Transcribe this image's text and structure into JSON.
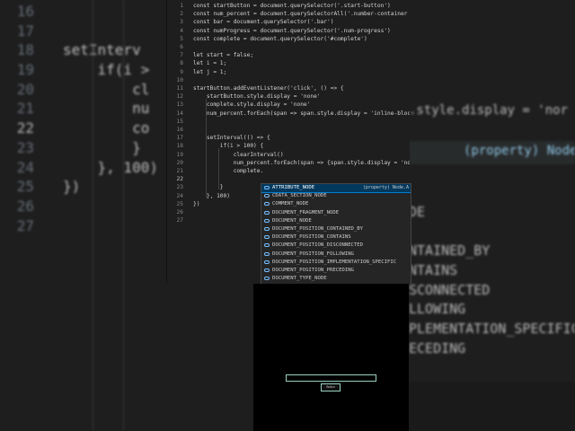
{
  "background": {
    "line_numbers": [
      "16",
      "17",
      "18",
      "19",
      "20",
      "21",
      "22",
      "23",
      "24",
      "25",
      "26",
      "27"
    ],
    "lines": [
      "",
      "",
      "setInterv",
      "    if(i >",
      "        cl",
      "        nu",
      "        co",
      "        }",
      "    }, 100)",
      "})",
      "",
      ""
    ],
    "right_top": ".style.display = 'nor",
    "hover_text": "(property) Node.A",
    "right_fragments": [
      "DE",
      "NTAINED_BY",
      "NTAINS",
      "SCONNECTED",
      "LLOWING",
      "PLEMENTATION_SPECIFIC",
      "ECEDING"
    ]
  },
  "editor": {
    "active_line": "22",
    "lines": [
      {
        "num": "1",
        "text": "const startButton = document.querySelector('.start-button')"
      },
      {
        "num": "2",
        "text": "const num_percent = document.querySelectorAll('.number-container span')"
      },
      {
        "num": "3",
        "text": "const bar = document.querySelector('.bar')"
      },
      {
        "num": "4",
        "text": "const numProgress = document.querySelector('.num-progress')"
      },
      {
        "num": "5",
        "text": "const complete = document.querySelector('#complete')"
      },
      {
        "num": "6",
        "text": ""
      },
      {
        "num": "7",
        "text": "let start = false;"
      },
      {
        "num": "8",
        "text": "let i = 1;"
      },
      {
        "num": "9",
        "text": "let j = 1;"
      },
      {
        "num": "10",
        "text": ""
      },
      {
        "num": "11",
        "text": "startButton.addEventListener('click', () => {"
      },
      {
        "num": "12",
        "text": "    startButton.style.display = 'none'"
      },
      {
        "num": "13",
        "text": "    complete.style.display = 'none'"
      },
      {
        "num": "14",
        "text": "    num_percent.forEach(span => span.style.display = 'inline-block')"
      },
      {
        "num": "15",
        "text": ""
      },
      {
        "num": "16",
        "text": ""
      },
      {
        "num": "17",
        "text": "    setInterval(() => {"
      },
      {
        "num": "18",
        "text": "        if(i > 100) {"
      },
      {
        "num": "19",
        "text": "            clearInterval()"
      },
      {
        "num": "20",
        "text": "            num_percent.forEach(span => {span.style.display = 'none'"
      },
      {
        "num": "21",
        "text": "            complete."
      },
      {
        "num": "22",
        "text": ""
      },
      {
        "num": "23",
        "text": "        }"
      },
      {
        "num": "24",
        "text": "    }, 100)"
      },
      {
        "num": "25",
        "text": "})"
      },
      {
        "num": "26",
        "text": ""
      },
      {
        "num": "27",
        "text": ""
      }
    ]
  },
  "suggest": {
    "selected_detail": "(property) Node.A",
    "items": [
      "ATTRIBUTE_NODE",
      "CDATA_SECTION_NODE",
      "COMMENT_NODE",
      "DOCUMENT_FRAGMENT_NODE",
      "DOCUMENT_NODE",
      "DOCUMENT_POSITION_CONTAINED_BY",
      "DOCUMENT_POSITION_CONTAINS",
      "DOCUMENT_POSITION_DISCONNECTED",
      "DOCUMENT_POSITION_FOLLOWING",
      "DOCUMENT_POSITION_IMPLEMENTATION_SPECIFIC",
      "DOCUMENT_POSITION_PRECEDING",
      "DOCUMENT_TYPE_NODE"
    ]
  },
  "preview": {
    "button_label": "Button"
  },
  "colors": {
    "editor_bg": "#1e1e1e",
    "suggest_bg": "#252526",
    "selection": "#04395e",
    "preview_accent": "#9ad0c2"
  }
}
